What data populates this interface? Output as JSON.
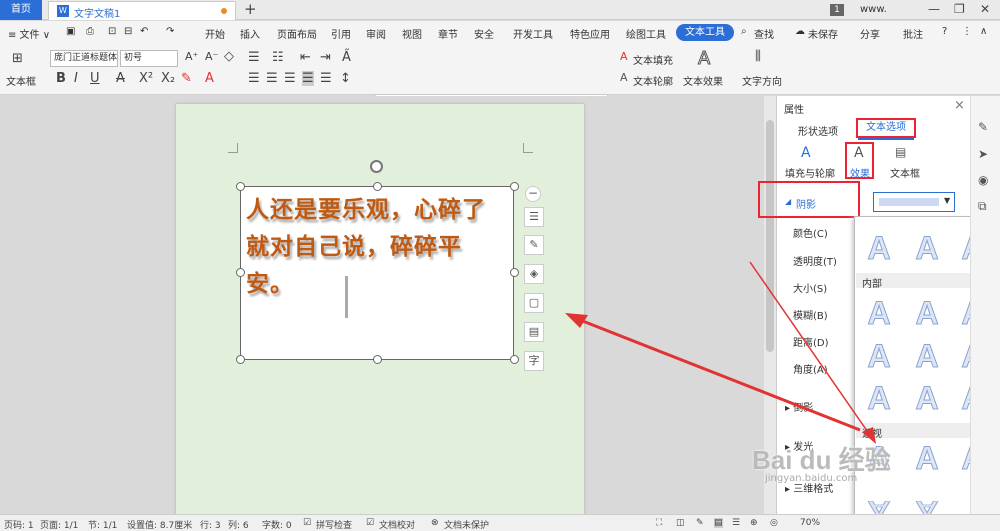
{
  "titlebar": {
    "home_tab": "首页",
    "doc_icon": "W",
    "doc_name": "文字文稿1",
    "new_tab": "+",
    "window_num": "1",
    "user": "www.",
    "min": "—",
    "max": "❐",
    "close": "✕"
  },
  "menubar": {
    "file": "≡ 文件 ∨",
    "items": [
      "开始",
      "插入",
      "页面布局",
      "引用",
      "审阅",
      "视图",
      "章节",
      "安全",
      "开发工具",
      "特色应用",
      "绘图工具"
    ],
    "active": "文本工具",
    "search": "查找",
    "unsaved": "未保存",
    "share": "分享",
    "annotate": "批注",
    "help": "?"
  },
  "ribbon": {
    "textbox_label": "文本框",
    "font_name": "庞门正道标题体",
    "font_size": "初号",
    "text_fill": "文本填充",
    "text_outline": "文本轮廓",
    "text_effect": "文本效果",
    "text_direction": "文字方向",
    "style_letter": "A"
  },
  "document": {
    "body_text": "人还是要乐观，心碎了就对自己说，碎碎平安。"
  },
  "float_toolbar": {
    "minus": "−",
    "char": "字"
  },
  "pane": {
    "title": "属性",
    "close": "×",
    "tab_shape": "形状选项",
    "tab_text": "文本选项",
    "sub_fill": "填充与轮廓",
    "sub_effect": "效果",
    "sub_textbox": "文本框",
    "shadow": "阴影",
    "props": [
      "颜色(C)",
      "透明度(T)",
      "大小(S)",
      "模糊(B)",
      "距离(D)",
      "角度(A)"
    ],
    "sections": [
      "倒影",
      "发光",
      "三维格式"
    ]
  },
  "dropdown": {
    "inner_label": "内部",
    "persp_label": "透视",
    "glyph": "A"
  },
  "status": {
    "page": "页码: 1",
    "pages": "页面: 1/1",
    "section": "节: 1/1",
    "setting": "设置值: 8.7厘米",
    "row": "行: 3",
    "col": "列: 6",
    "words": "字数: 0",
    "spell": "拼写检查",
    "proof": "文档校对",
    "protect": "文档未保护",
    "zoom": "70%"
  },
  "watermark": {
    "brand": "Bai du 经验",
    "url": "jingyan.baidu.com"
  },
  "colors": {
    "accent": "#2b6fd6",
    "highlight": "#e23333",
    "body_text": "#c05a12"
  }
}
